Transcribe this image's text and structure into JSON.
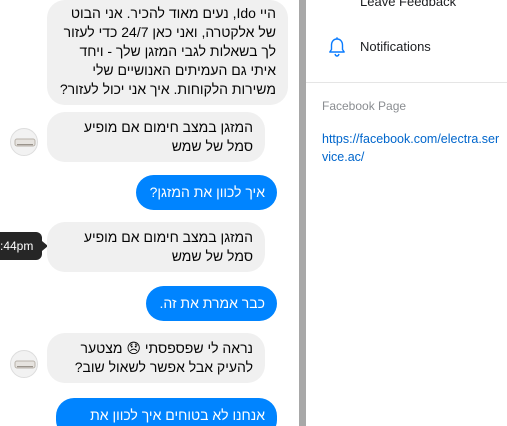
{
  "chat": {
    "messages": [
      {
        "from": "bot",
        "text": "היי Ido, נעים מאוד להכיר. אני הבוט של אלקטרה, ואני כאן 24/7 כדי לעזור לך בשאלות לגבי המזגן שלך - ויחד איתי גם העמיתים האנושיים שלי משירות הלקוחות. איך אני יכול לעזור?"
      },
      {
        "from": "bot",
        "text": "המזגן במצב חימום אם מופיע סמל של שמש"
      },
      {
        "from": "user",
        "text": "איך לכוון את המזגן?"
      },
      {
        "from": "bot",
        "text": "המזגן במצב חימום אם מופיע סמל של שמש"
      },
      {
        "from": "user",
        "text": "כבר אמרת את זה."
      },
      {
        "from": "bot",
        "text": "נראה לי שפספסתי 😞 מצטער להעיק אבל אפשר לשאול שוב?"
      },
      {
        "from": "user",
        "text": "אנחנו לא בטוחים איך לכוון את"
      }
    ],
    "tooltip_time": ":44pm"
  },
  "panel": {
    "leave_feedback": "Leave Feedback",
    "notifications": "Notifications",
    "facebook_page_title": "Facebook Page",
    "facebook_page_url": "https://facebook.com/electra.service.ac/"
  },
  "colors": {
    "outgoing_bubble": "#0084ff",
    "incoming_bubble": "#f0f0f0",
    "link": "#0066cc"
  }
}
